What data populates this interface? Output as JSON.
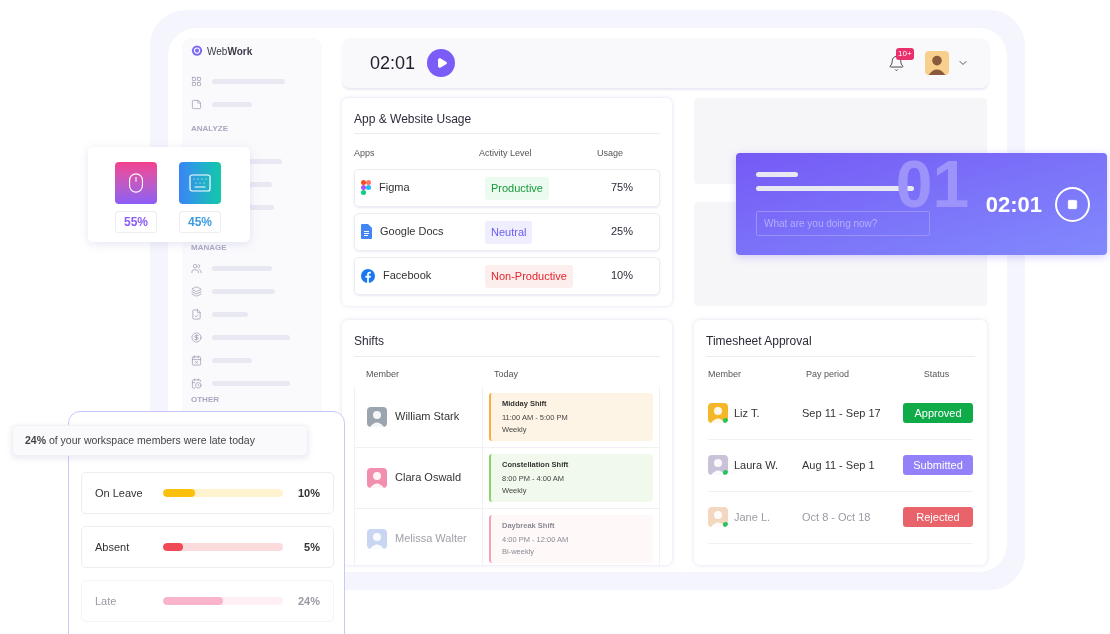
{
  "brand": {
    "name": "Web**Work**"
  },
  "sidebar": {
    "sections": [
      {
        "label": "ANALYZE"
      },
      {
        "label": "MANAGE"
      },
      {
        "label": "OTHER"
      }
    ]
  },
  "header": {
    "time": "02:01",
    "notification_count": "10+"
  },
  "app_usage": {
    "title": "App & Website Usage",
    "columns": [
      "Apps",
      "Activity Level",
      "Usage"
    ],
    "rows": [
      {
        "kind": "figma",
        "app": "Figma",
        "activity": {
          "label": "Productive",
          "kind": "productive"
        },
        "usage": "75%"
      },
      {
        "kind": "docs",
        "app": "Google Docs",
        "activity": {
          "label": "Neutral",
          "kind": "neutral"
        },
        "usage": "25%"
      },
      {
        "kind": "facebook",
        "app": "Facebook",
        "activity": {
          "label": "Non-Productive",
          "kind": "non_productive"
        },
        "usage": "10%"
      }
    ]
  },
  "shifts": {
    "title": "Shifts",
    "columns": [
      "Member",
      "Today"
    ],
    "rows": [
      {
        "member": "William Stark",
        "shift": "Midday Shift",
        "time": "11:00 AM - 5:00 PM",
        "repeat": "Weekly",
        "color": "#f5b041",
        "faded": false
      },
      {
        "member": "Clara Oswald",
        "shift": "Constellation Shift",
        "time": "8:00 PM - 4:00 AM",
        "repeat": "Weekly",
        "color": "#8bd16a",
        "faded": false
      },
      {
        "member": "Melissa Walter",
        "shift": "Daybreak Shift",
        "time": "4:00 PM - 12:00 AM",
        "repeat": "Bi-weekly",
        "color": "#f7a1b5",
        "faded": true
      }
    ]
  },
  "timesheet": {
    "title": "Timesheet Approval",
    "columns": [
      "Member",
      "Pay period",
      "Status"
    ],
    "rows": [
      {
        "member": "Liz T.",
        "period": "Sep 11 - Sep 17",
        "status": {
          "label": "Approved",
          "kind": "approved"
        },
        "faded": false
      },
      {
        "member": "Laura W.",
        "period": "Aug 11 - Sep 1",
        "status": {
          "label": "Submitted",
          "kind": "submitted"
        },
        "faded": false
      },
      {
        "member": "Jane L.",
        "period": "Oct 8 - Oct 18",
        "status": {
          "label": "Rejected",
          "kind": "rejected"
        },
        "faded": true
      }
    ]
  },
  "input_stats": [
    {
      "kind": "mouse",
      "value": "55%"
    },
    {
      "kind": "keyboard",
      "value": "45%"
    }
  ],
  "timer_card": {
    "placeholder": "What are you doing now?",
    "watermark": "01",
    "time": "02:01"
  },
  "attendance": {
    "note": "**24%** of your workspace members were late today",
    "rows": [
      {
        "label": "On Leave",
        "level": 0.27,
        "reading": "10%",
        "color": "#fbbf0e",
        "faded": false
      },
      {
        "label": "Absent",
        "level": 0.17,
        "reading": "5%",
        "color": "#ef4a56",
        "faded": false
      },
      {
        "label": "Late",
        "level": 0.5,
        "reading": "24%",
        "color": "#f9b4cc",
        "faded": true
      }
    ]
  }
}
